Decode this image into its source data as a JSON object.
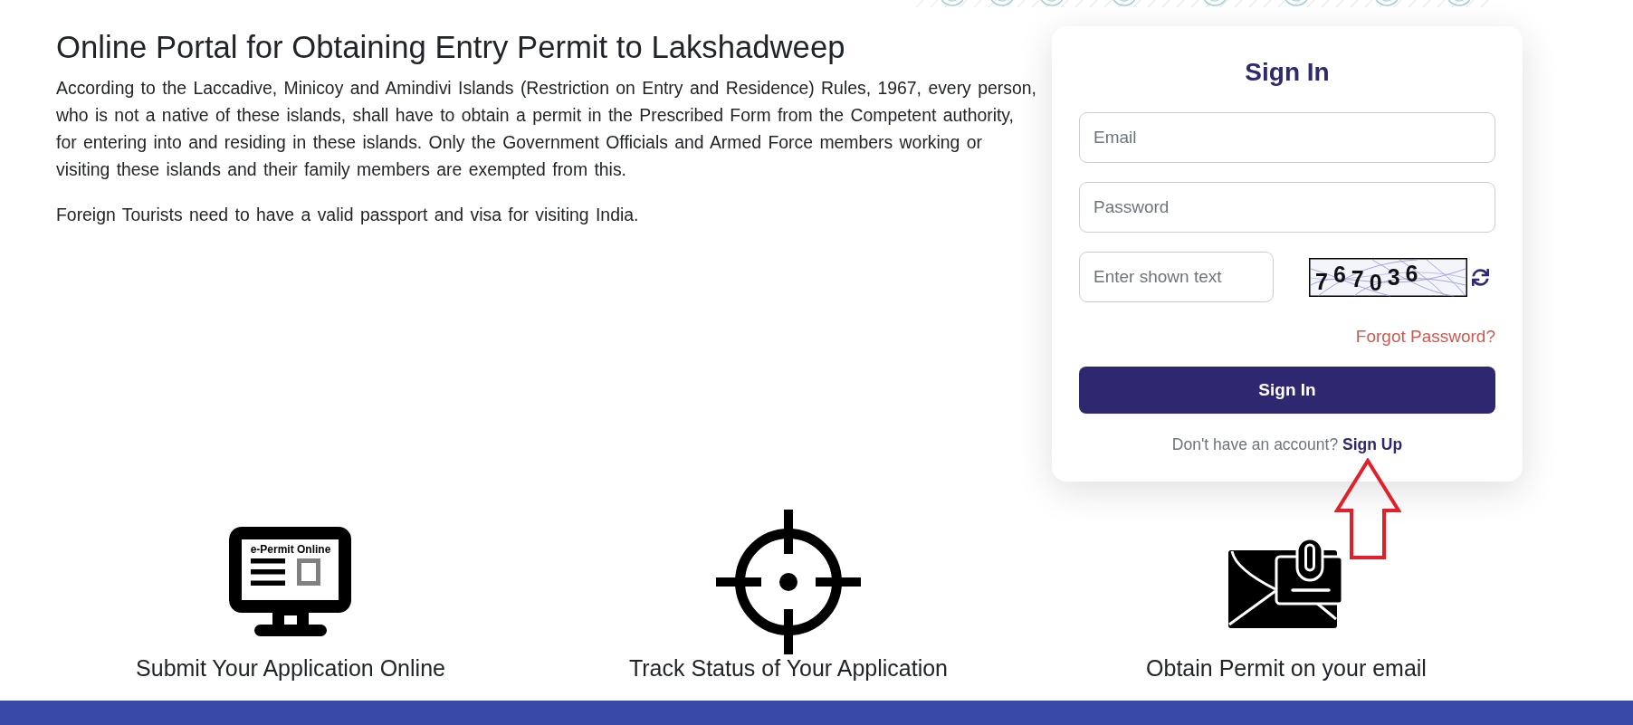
{
  "intro": {
    "title": "Online Portal for Obtaining Entry Permit to Lakshadweep",
    "paragraphs": [
      "According to the Laccadive, Minicoy and Amindivi Islands (Restriction on Entry and Residence) Rules, 1967, every person, who is not a native of these islands, shall have to obtain a permit in the Prescribed Form from the Competent authority, for entering into and residing in these islands. Only the Government Officials and Armed Force members working or visiting these islands and their family members are exempted from this.",
      "Foreign Tourists need to have a valid passport and visa for visiting India."
    ]
  },
  "sign_in": {
    "title": "Sign In",
    "email_field": {
      "placeholder": "Email"
    },
    "password_field": {
      "placeholder": "Password"
    },
    "captcha": {
      "placeholder": "Enter shown text",
      "image_text": "767036"
    },
    "forgot_link": "Forgot Password?",
    "submit_button": "Sign In",
    "signup_prompt": "Don't have an account?",
    "signup_link": "Sign Up"
  },
  "features": [
    {
      "kind": "monitor",
      "label": "Submit Your Application Online",
      "screen_text": "e-Permit Online"
    },
    {
      "kind": "crosshair",
      "label": "Track Status of Your Application"
    },
    {
      "kind": "envelope",
      "label": "Obtain Permit on your email"
    }
  ]
}
